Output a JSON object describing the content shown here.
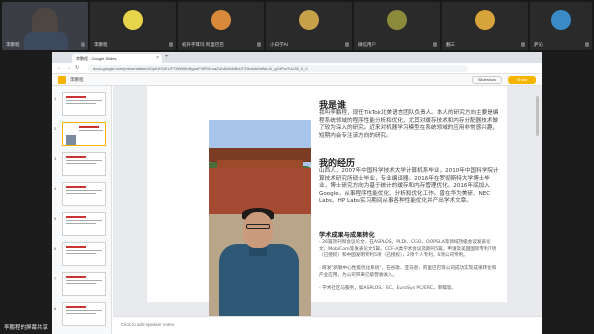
{
  "participants": [
    {
      "name": "李鹏程",
      "type": "video"
    },
    {
      "name": "李鹏程",
      "type": "avatar",
      "color": "#e6d44b"
    },
    {
      "name": "初升宇耳玛 阿里巴巴",
      "type": "avatar",
      "color": "#d88a3a"
    },
    {
      "name": "小白学AI",
      "type": "avatar",
      "color": "#c7a04a"
    },
    {
      "name": "微信用户",
      "type": "avatar",
      "color": "#8a8a3a"
    },
    {
      "name": "翻三",
      "type": "avatar",
      "color": "#d6a43a"
    },
    {
      "name": "萨沁",
      "type": "avatar",
      "color": "#3a8ac7"
    }
  ],
  "browser": {
    "tab_title": "李鹏程 - Google Slides",
    "url": "docs.google.com/presentation/d/1pfUKGEUFT5WMKrBgnuFVfEW-sa2Uh8oN4dfbUT/Dbz6A9aWa-6/_g/1tFtuTUc28_0_0"
  },
  "slides_app": {
    "title": "李鹏程",
    "slideshow_label": "Slideshow",
    "share_label": "Share"
  },
  "slide": {
    "heading1": "我是谁",
    "intro": "我叫李鹏程，现任TikTok北美语言团队负责人。本人的研究方向主要是编程系统领域的程序性能分析和优化，尤其对缓存技术和内存分配器技术做了较为深入的研究。近来对机器学习模型在系统领域的应用非常感兴趣，短期内会专注该方向的研究。",
    "heading2": "我的经历",
    "experience": "山西人，2007年中国科学技术大学计算机系毕业，2010年中国科学院计算技术研究所硕士毕业，专业编译器。2016年在罗彻斯特大学博士毕业，博士研究方向为基于统计的缓存和内存管理优化。2016年底加入Google，从事程序性能优化、分析和优化工作。曾在华为美研、NEC Labs、HP Labs实习期间从事各种性能优化并产出学术文章。",
    "heading3": "学术成果与成果转化",
    "bullet1": "- 26篇顶刊和会议论文，在ASPLOS、PLDI、CGO、OOPSLA等领域顶级会议发表论文，MobiCom等发表论文5篇，CCF-A类学术会议及期刊5篇，申请及美国国际专利7项（已授权）和中国发明专利5项（已授权），2项个人专利，6项公司专利。",
    "bullet2": "- 研发\"新颖中心性能优化系统\"，在谷歌、亚马逊、阿里巴巴等公司成功实现成果转化和产业应用，为公司带来亿级营收收入。",
    "bullet3": "- 学术社区与服务，如ASPLOS、SC、EuroSys PC/ERC，审稿等。"
  },
  "notes_placeholder": "Click to add speaker notes",
  "presenter_label": "李鹏程的屏幕共享"
}
